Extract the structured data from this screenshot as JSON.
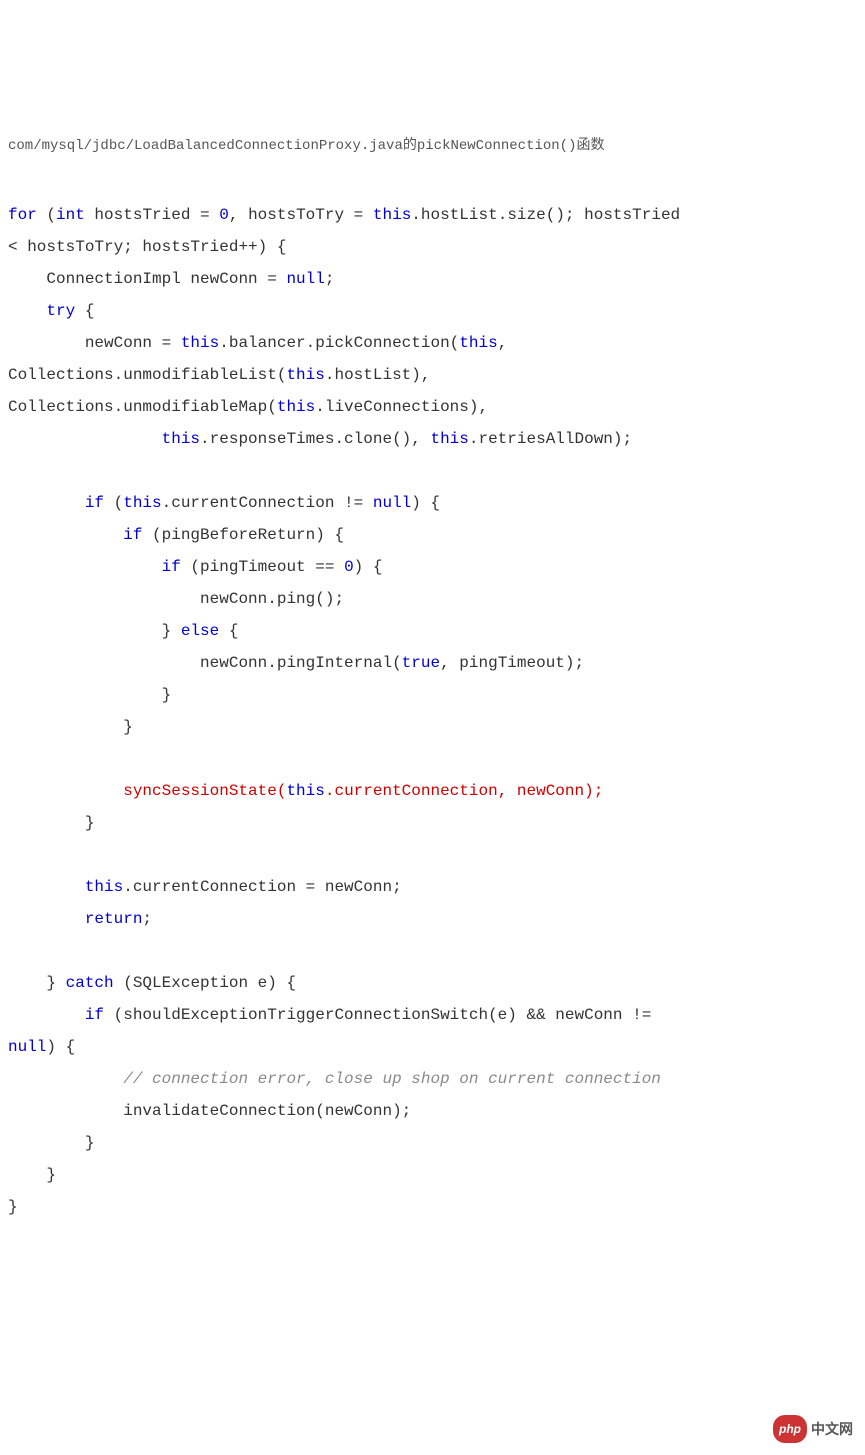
{
  "header": "com/mysql/jdbc/LoadBalancedConnectionProxy.java的pickNewConnection()函数",
  "code": {
    "l1a": "for",
    "l1b": " (",
    "l1c": "int",
    "l1d": " hostsTried = ",
    "l1e": "0",
    "l1f": ", hostsToTry = ",
    "l1g": "this",
    "l1h": ".hostList.size(); hostsTried ",
    "l2a": "< hostsToTry; hostsTried++) {",
    "l3a": "    ConnectionImpl newConn = ",
    "l3b": "null",
    "l3c": ";",
    "l4a": "    ",
    "l4b": "try",
    "l4c": " {",
    "l5a": "        newConn = ",
    "l5b": "this",
    "l5c": ".balancer.pickConnection(",
    "l5d": "this",
    "l5e": ", ",
    "l6a": "Collections.unmodifiableList(",
    "l6b": "this",
    "l6c": ".hostList), ",
    "l7a": "Collections.unmodifiableMap(",
    "l7b": "this",
    "l7c": ".liveConnections),",
    "l8a": "                ",
    "l8b": "this",
    "l8c": ".responseTimes.clone(), ",
    "l8d": "this",
    "l8e": ".retriesAllDown);",
    "l10a": "        ",
    "l10b": "if",
    "l10c": " (",
    "l10d": "this",
    "l10e": ".currentConnection != ",
    "l10f": "null",
    "l10g": ") {",
    "l11a": "            ",
    "l11b": "if",
    "l11c": " (pingBeforeReturn) {",
    "l12a": "                ",
    "l12b": "if",
    "l12c": " (pingTimeout == ",
    "l12d": "0",
    "l12e": ") {",
    "l13a": "                    newConn.ping();",
    "l14a": "                } ",
    "l14b": "else",
    "l14c": " {",
    "l15a": "                    newConn.pingInternal(",
    "l15b": "true",
    "l15c": ", pingTimeout);",
    "l16a": "                }",
    "l17a": "            }",
    "l19a": "            ",
    "l19b": "syncSessionState(",
    "l19c": "this",
    "l19d": ".currentConnection, newConn);",
    "l20a": "        }",
    "l22a": "        ",
    "l22b": "this",
    "l22c": ".currentConnection = newConn;",
    "l23a": "        ",
    "l23b": "return",
    "l23c": ";",
    "l25a": "    } ",
    "l25b": "catch",
    "l25c": " (SQLException e) {",
    "l26a": "        ",
    "l26b": "if",
    "l26c": " (shouldExceptionTriggerConnectionSwitch(e) && newConn != ",
    "l27a": "null",
    "l27b": ") {",
    "l28a": "            ",
    "l28b": "// connection error, close up shop on current connection",
    "l29a": "            invalidateConnection(newConn);",
    "l30a": "        }",
    "l31a": "    }",
    "l32a": "}"
  },
  "watermark": {
    "logo": "php",
    "text": "中文网"
  }
}
